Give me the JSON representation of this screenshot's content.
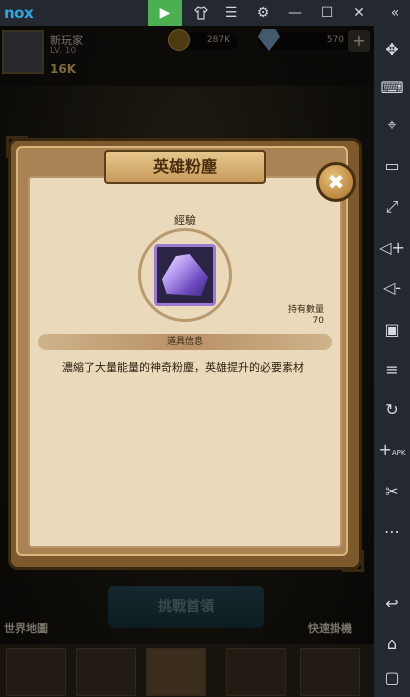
{
  "emulator": {
    "logo": "nox",
    "top_buttons": [
      "play-store-icon",
      "shirt-icon",
      "menu-icon",
      "gear-icon",
      "minimize-icon",
      "maximize-icon",
      "close-icon",
      "collapse-icon"
    ],
    "sidebar_icons": [
      "gamepad-icon",
      "keyboard-icon",
      "location-icon",
      "screen-icon",
      "fullscreen-icon",
      "volume-up-icon",
      "volume-down-icon",
      "screenshot-icon",
      "shake-icon",
      "rotate-icon",
      "apk-install-icon",
      "scissors-icon",
      "more-icon",
      "back-icon",
      "home-icon",
      "recent-apps-icon"
    ],
    "apk_label": "APK",
    "accent_color": "#2ea7e0"
  },
  "hud": {
    "player_name": "新玩家",
    "player_level": "LV. 10",
    "power": "16K",
    "gold": "287K",
    "gems": "570"
  },
  "modal": {
    "title": "英雄粉塵",
    "category": "經驗",
    "owned_label": "持有數量",
    "owned_value": "70",
    "section_label": "道具信息",
    "description": "濃縮了大量能量的神奇粉塵，英雄提升的必要素材",
    "close_glyph": "✖"
  },
  "background": {
    "challenge_button": "挑戰首領",
    "world_map": "世界地圖",
    "quick_hunt": "快速掛機"
  }
}
